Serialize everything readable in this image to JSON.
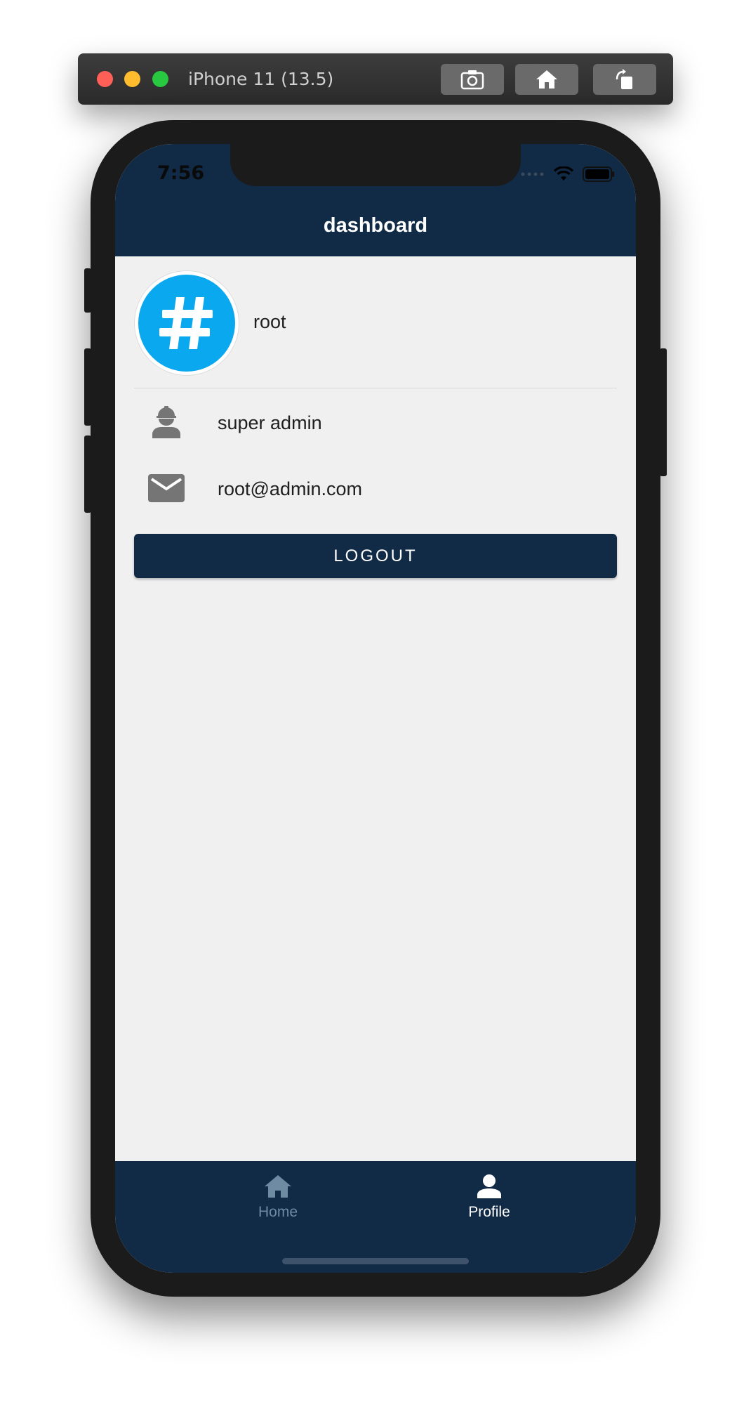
{
  "simulator": {
    "title": "iPhone 11 (13.5)",
    "buttons": [
      "screenshot-icon",
      "home-icon",
      "rotate-icon"
    ]
  },
  "status_bar": {
    "time": "7:56"
  },
  "header": {
    "title": "dashboard"
  },
  "profile": {
    "username": "root",
    "role": "super admin",
    "email": "root@admin.com",
    "avatar_symbol": "#",
    "avatar_color": "#09a8ef"
  },
  "actions": {
    "logout_label": "LOGOUT"
  },
  "tabs": [
    {
      "label": "Home",
      "icon": "home-icon",
      "active": false
    },
    {
      "label": "Profile",
      "icon": "person-icon",
      "active": true
    }
  ],
  "colors": {
    "primary": "#112b47",
    "background": "#f0f0f1",
    "inactive_tab": "#6f8aa3"
  }
}
